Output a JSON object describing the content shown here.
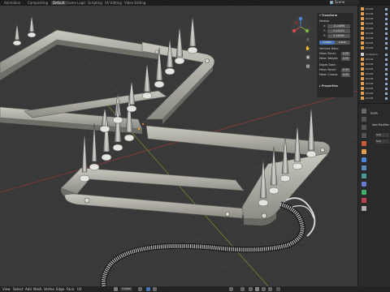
{
  "workspace_tabs": [
    {
      "label": "Animation",
      "active": false
    },
    {
      "label": "Compositing",
      "active": false
    },
    {
      "label": "Default",
      "active": true
    },
    {
      "label": "Game Logic",
      "active": false
    },
    {
      "label": "Scripting",
      "active": false
    },
    {
      "label": "UV Editing",
      "active": false
    },
    {
      "label": "Video Editing",
      "active": false
    }
  ],
  "scene": {
    "label": "Scene"
  },
  "n_panel": {
    "transform_title": "Transform",
    "median_label": "Median:",
    "x_label": "X:",
    "x_value": "-0.14896",
    "y_label": "Y:",
    "y_value": "0.44120",
    "z_label": "Z:",
    "z_value": "0.18008",
    "global_label": "Global",
    "local_label": "Local",
    "vertices_data_label": "Vertices Data:",
    "mean_bevel_label": "Mean Bevel:",
    "mean_bevel_value": "0.00",
    "mean_weight_label": "Mean Weight:",
    "mean_weight_value": "0.00",
    "edges_data_label": "Edges Data:",
    "edge_mean_bevel_label": "Mean Bevel:",
    "edge_mean_bevel_value": "0.00",
    "mean_crease_label": "Mean Crease:",
    "mean_crease_value": "0.00",
    "properties_title": "Properties"
  },
  "outliner": {
    "rows": [
      {
        "label": "ROOM",
        "color": "#e0a050"
      },
      {
        "label": "ROOM",
        "color": "#e0a050"
      },
      {
        "label": "ROOM",
        "color": "#e0a050"
      },
      {
        "label": "ROOM",
        "color": "#e0a050"
      },
      {
        "label": "ROOM",
        "color": "#e0a050"
      },
      {
        "label": "ROOM",
        "color": "#e0a050"
      },
      {
        "label": "ROOM",
        "color": "#e0a050"
      },
      {
        "label": "ROOM",
        "color": "#e0a050"
      },
      {
        "label": "ROOM",
        "color": "#e0a050"
      },
      {
        "label": "Collection",
        "color": "#d0d0d0"
      },
      {
        "label": "ROOM",
        "color": "#e0a050"
      },
      {
        "label": "ROOM",
        "color": "#e0a050"
      },
      {
        "label": "ROOM",
        "color": "#e0a050"
      },
      {
        "label": "ROOM",
        "color": "#e0a050"
      },
      {
        "label": "ROOM",
        "color": "#e0a050"
      },
      {
        "label": "ROOM",
        "color": "#e0a050"
      },
      {
        "label": "ROOM",
        "color": "#e0a050"
      },
      {
        "label": "ROOM",
        "color": "#e0a050"
      },
      {
        "label": "ROOM",
        "color": "#e0a050"
      },
      {
        "label": "ROOM",
        "color": "#e0a050"
      }
    ]
  },
  "properties_panel": {
    "object_name": "RSPR",
    "add_modifier_label": "Add Modifier",
    "subdivision_label": "Sub",
    "subdivision_value": "Sub"
  },
  "header_menu": [
    "View",
    "Select",
    "Add",
    "Mesh",
    "Vertex",
    "Edge",
    "Face",
    "UV"
  ],
  "header_controls": {
    "orientation": "Global",
    "pivot": "∙"
  },
  "colors": {
    "accent_blue": "#4772b3",
    "selected_orange": "#f0a030"
  }
}
